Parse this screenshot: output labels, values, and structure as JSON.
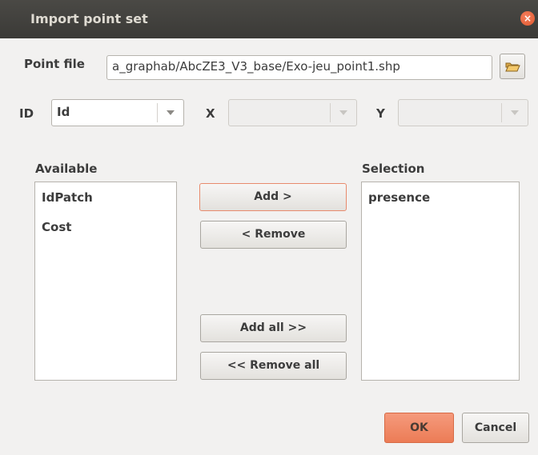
{
  "window": {
    "title": "Import point set",
    "close_icon": "close-icon"
  },
  "point_file": {
    "label": "Point file",
    "value": "a_graphab/AbcZE3_V3_base/Exo-jeu_point1.shp",
    "browse_icon": "folder-open-icon"
  },
  "id_field": {
    "label": "ID",
    "value": "Id"
  },
  "x_field": {
    "label": "X",
    "value": ""
  },
  "y_field": {
    "label": "Y",
    "value": ""
  },
  "available": {
    "label": "Available",
    "items": [
      "IdPatch",
      "Cost"
    ]
  },
  "selection": {
    "label": "Selection",
    "items": [
      "presence"
    ]
  },
  "buttons": {
    "add": "Add >",
    "remove": "< Remove",
    "add_all": "Add all >>",
    "remove_all": "<< Remove all",
    "ok": "OK",
    "cancel": "Cancel"
  },
  "colors": {
    "accent": "#ec7c56",
    "titlebar": "#3c3b37",
    "background": "#f2f1f0"
  }
}
